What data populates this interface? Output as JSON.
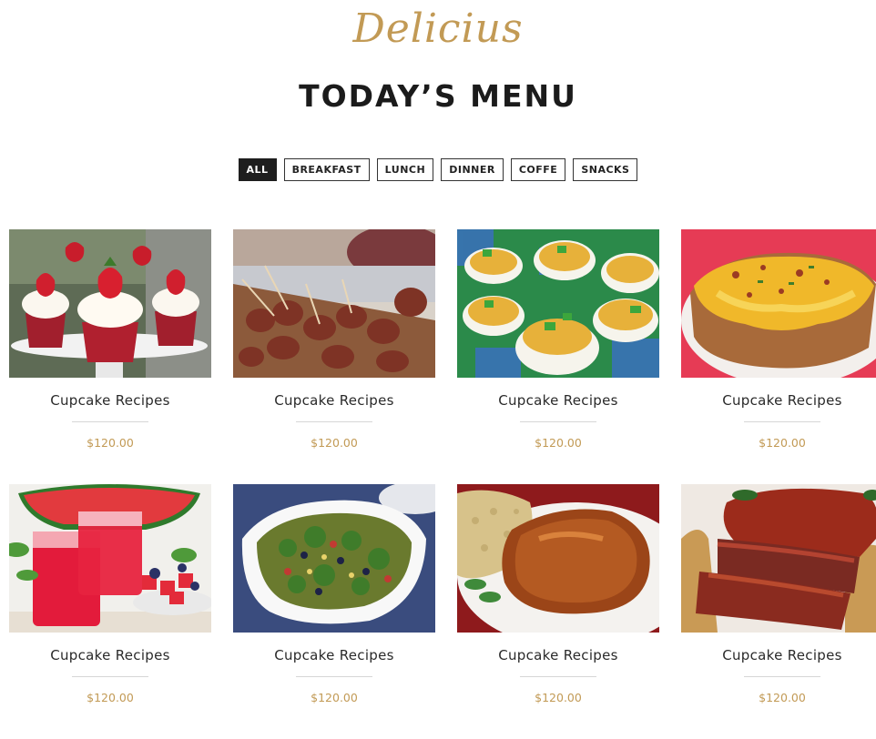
{
  "header": {
    "script_title": "Delicius",
    "menu_title": "TODAY’S MENU"
  },
  "filters": [
    {
      "label": "ALL",
      "active": true
    },
    {
      "label": "BREAKFAST",
      "active": false
    },
    {
      "label": "LUNCH",
      "active": false
    },
    {
      "label": "DINNER",
      "active": false
    },
    {
      "label": "COFFE",
      "active": false
    },
    {
      "label": "SNACKS",
      "active": false
    }
  ],
  "items": [
    {
      "title": "Cupcake Recipes",
      "price": "$120.00",
      "image": "strawberry-cupcakes"
    },
    {
      "title": "Cupcake Recipes",
      "price": "$120.00",
      "image": "bacon-wrapped-skewers"
    },
    {
      "title": "Cupcake Recipes",
      "price": "$120.00",
      "image": "deviled-eggs"
    },
    {
      "title": "Cupcake Recipes",
      "price": "$120.00",
      "image": "loaded-baked-potato"
    },
    {
      "title": "Cupcake Recipes",
      "price": "$120.00",
      "image": "watermelon-drinks"
    },
    {
      "title": "Cupcake Recipes",
      "price": "$120.00",
      "image": "quinoa-salad-bowl"
    },
    {
      "title": "Cupcake Recipes",
      "price": "$120.00",
      "image": "glazed-pork-chop"
    },
    {
      "title": "Cupcake Recipes",
      "price": "$120.00",
      "image": "glazed-meatloaf"
    }
  ],
  "colors": {
    "accent_gold": "#c29a55",
    "dark": "#1e1e1e"
  }
}
